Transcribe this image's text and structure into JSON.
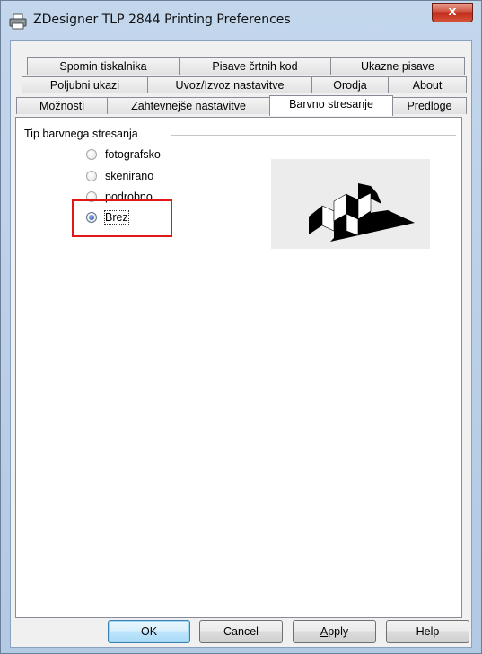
{
  "window": {
    "title": "ZDesigner TLP 2844 Printing Preferences",
    "close_label": "x"
  },
  "tabs": {
    "row1": [
      "Spomin tiskalnika",
      "Pisave črtnih kod",
      "Ukazne pisave"
    ],
    "row2": [
      "Poljubni ukazi",
      "Uvoz/Izvoz nastavitve",
      "Orodja",
      "About"
    ],
    "row3": [
      "Možnosti",
      "Zahtevnejše nastavitve",
      "Barvno stresanje",
      "Predloge"
    ],
    "active": "Barvno stresanje"
  },
  "dither": {
    "group_title": "Tip barvnega stresanja",
    "options": [
      "fotografsko",
      "skenirano",
      "podrobno",
      "Brez"
    ],
    "selected": "Brez"
  },
  "buttons": {
    "ok": "OK",
    "cancel": "Cancel",
    "apply_mnemonic": "A",
    "apply_rest": "pply",
    "help": "Help"
  },
  "colors": {
    "highlight": "#e01818",
    "close_button": "#c0291a"
  },
  "icons": [
    "printer-icon",
    "close-icon",
    "dither-preview-icon"
  ]
}
